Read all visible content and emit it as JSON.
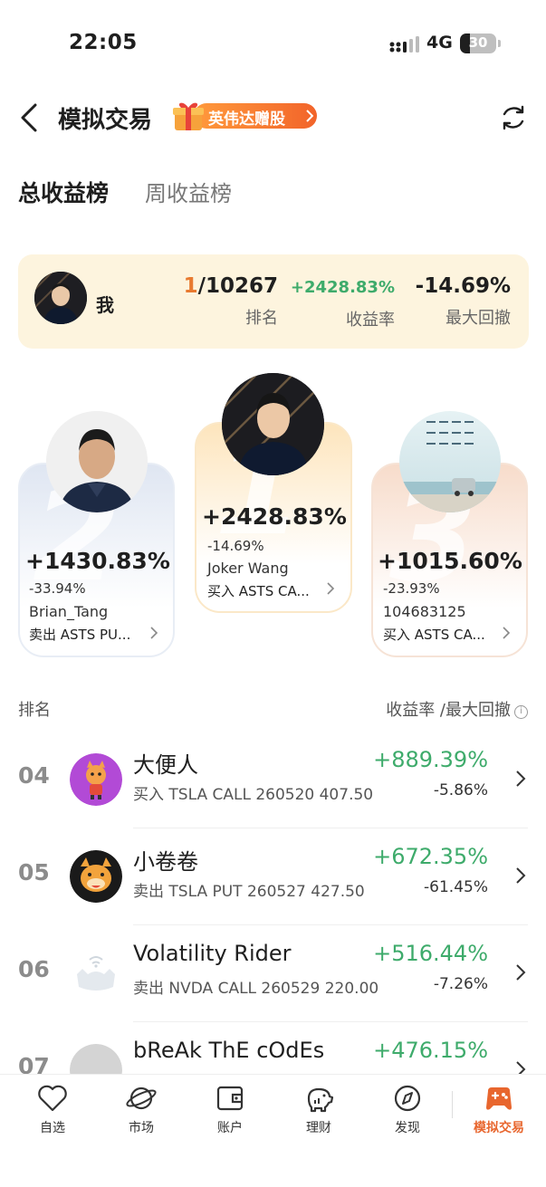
{
  "status_bar": {
    "time": "22:05",
    "network": "4G",
    "battery": "30"
  },
  "header": {
    "title": "模拟交易",
    "promo": "英伟达赠股"
  },
  "tabs": [
    {
      "label": "总收益榜"
    },
    {
      "label": "周收益榜"
    }
  ],
  "my_card": {
    "name": "我",
    "rank_current": "1",
    "rank_total": "/10267",
    "rank_label": "排名",
    "return": "+2428.83%",
    "return_label": "收益率",
    "drawdown": "-14.69%",
    "drawdown_label": "最大回撤"
  },
  "podium": {
    "second": {
      "place": "2",
      "return": "+1430.83%",
      "drawdown": "-33.94%",
      "name": "Brian_Tang",
      "trade": "卖出 ASTS PU..."
    },
    "first": {
      "place": "1",
      "return": "+2428.83%",
      "drawdown": "-14.69%",
      "name": "Joker Wang",
      "trade": "买入 ASTS CA..."
    },
    "third": {
      "place": "3",
      "return": "+1015.60%",
      "drawdown": "-23.93%",
      "name": "104683125",
      "trade": "买入 ASTS CA..."
    }
  },
  "list_header": {
    "left": "排名",
    "right": "收益率 /最大回撤"
  },
  "rows": [
    {
      "rank": "04",
      "name": "大便人",
      "trade": "买入 TSLA CALL 260520 407.50",
      "return": "+889.39%",
      "drawdown": "-5.86%"
    },
    {
      "rank": "05",
      "name": "小卷卷",
      "trade": "卖出 TSLA PUT 260527 427.50",
      "return": "+672.35%",
      "drawdown": "-61.45%"
    },
    {
      "rank": "06",
      "name": "Volatility Rider",
      "trade": "卖出 NVDA CALL 260529 220.00",
      "return": "+516.44%",
      "drawdown": "-7.26%"
    },
    {
      "rank": "07",
      "name": "bReAk ThE cOdEs",
      "trade": "",
      "return": "+476.15%",
      "drawdown": ""
    }
  ],
  "nav": [
    {
      "label": "自选",
      "icon": "heart-icon"
    },
    {
      "label": "市场",
      "icon": "planet-icon"
    },
    {
      "label": "账户",
      "icon": "wallet-icon"
    },
    {
      "label": "理财",
      "icon": "piggy-bank-icon"
    },
    {
      "label": "发现",
      "icon": "compass-icon"
    },
    {
      "label": "模拟交易",
      "icon": "gamepad-icon",
      "active": true
    }
  ],
  "colors": {
    "accent": "#e8662e",
    "positive": "#3eab6b",
    "my_card_bg": "#fdf4de"
  }
}
